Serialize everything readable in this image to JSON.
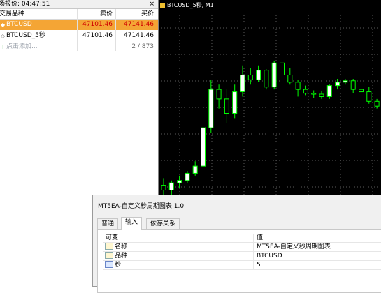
{
  "market_watch": {
    "title": "场报价: 04:47:51",
    "close_glyph": "×",
    "columns": {
      "symbol": "交易品种",
      "bid": "卖价",
      "ask": "买价"
    },
    "rows": [
      {
        "icon": "◆",
        "symbol": "BTCUSD",
        "bid": "47101.46",
        "ask": "47141.46",
        "selected": true
      },
      {
        "icon": "◇",
        "symbol": "BTCUSD_5秒",
        "bid": "47101.46",
        "ask": "47141.46",
        "selected": false
      },
      {
        "icon": "+",
        "symbol": "点击添加...",
        "bid": "",
        "ask": "2 / 873",
        "selected": false
      }
    ]
  },
  "chart": {
    "title": "BTCUSD_5秒, M1",
    "background": "#000000",
    "up_color": "#00ff00",
    "body_up_fill": "#ffffff",
    "body_down_fill": "#000000",
    "candles": [
      {
        "o": 47040,
        "h": 47055,
        "l": 47010,
        "c": 47030
      },
      {
        "o": 47030,
        "h": 47050,
        "l": 47020,
        "c": 47045
      },
      {
        "o": 47045,
        "h": 47060,
        "l": 47035,
        "c": 47050
      },
      {
        "o": 47050,
        "h": 47070,
        "l": 47045,
        "c": 47065
      },
      {
        "o": 47065,
        "h": 47090,
        "l": 47060,
        "c": 47080
      },
      {
        "o": 47080,
        "h": 47180,
        "l": 47070,
        "c": 47160
      },
      {
        "o": 47160,
        "h": 47260,
        "l": 47150,
        "c": 47240
      },
      {
        "o": 47240,
        "h": 47250,
        "l": 47200,
        "c": 47220
      },
      {
        "o": 47220,
        "h": 47240,
        "l": 47170,
        "c": 47190
      },
      {
        "o": 47190,
        "h": 47250,
        "l": 47180,
        "c": 47235
      },
      {
        "o": 47235,
        "h": 47290,
        "l": 47225,
        "c": 47270
      },
      {
        "o": 47270,
        "h": 47285,
        "l": 47250,
        "c": 47260
      },
      {
        "o": 47260,
        "h": 47290,
        "l": 47255,
        "c": 47280
      },
      {
        "o": 47280,
        "h": 47282,
        "l": 47240,
        "c": 47245
      },
      {
        "o": 47245,
        "h": 47300,
        "l": 47240,
        "c": 47295
      },
      {
        "o": 47295,
        "h": 47300,
        "l": 47265,
        "c": 47270
      },
      {
        "o": 47270,
        "h": 47285,
        "l": 47250,
        "c": 47255
      },
      {
        "o": 47255,
        "h": 47260,
        "l": 47225,
        "c": 47240
      },
      {
        "o": 47240,
        "h": 47248,
        "l": 47228,
        "c": 47232
      },
      {
        "o": 47232,
        "h": 47238,
        "l": 47222,
        "c": 47230
      },
      {
        "o": 47230,
        "h": 47236,
        "l": 47220,
        "c": 47225
      },
      {
        "o": 47225,
        "h": 47250,
        "l": 47220,
        "c": 47248
      },
      {
        "o": 47248,
        "h": 47262,
        "l": 47240,
        "c": 47255
      },
      {
        "o": 47255,
        "h": 47262,
        "l": 47250,
        "c": 47258
      },
      {
        "o": 47258,
        "h": 47262,
        "l": 47232,
        "c": 47240
      },
      {
        "o": 47240,
        "h": 47252,
        "l": 47230,
        "c": 47235
      },
      {
        "o": 47235,
        "h": 47245,
        "l": 47210,
        "c": 47215
      },
      {
        "o": 47215,
        "h": 47220,
        "l": 47200,
        "c": 47205
      }
    ]
  },
  "dialog": {
    "title": "MT5EA-自定义秒周期图表 1.0",
    "tabs": [
      "普通",
      "输入",
      "依存关系"
    ],
    "active_tab": "输入",
    "table_headers": {
      "variable": "可变",
      "value": "值"
    },
    "params": [
      {
        "icon": "abc-icon",
        "name": "名称",
        "value": "MT5EA-自定义秒周期图表"
      },
      {
        "icon": "abc-icon",
        "name": "品种",
        "value": "BTCUSD"
      },
      {
        "icon": "123-icon",
        "name": "秒",
        "value": "5"
      }
    ]
  }
}
